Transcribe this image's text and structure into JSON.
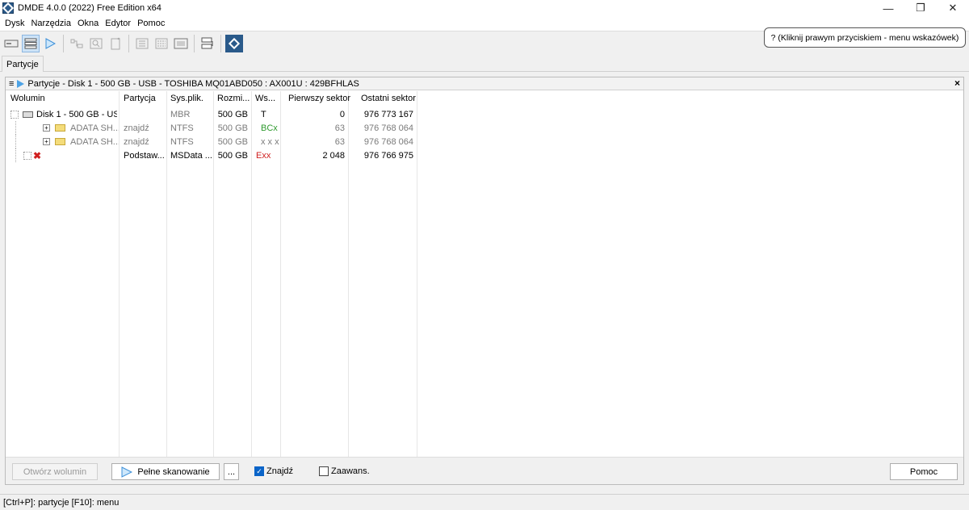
{
  "window": {
    "title": "DMDE 4.0.0 (2022) Free Edition x64",
    "minimize": "—",
    "restore": "❐",
    "close": "✕"
  },
  "menu": [
    "Dysk",
    "Narzędzia",
    "Okna",
    "Edytor",
    "Pomoc"
  ],
  "tooltip": "? (Kliknij prawym przyciskiem - menu wskazówek)",
  "tab": "Partycje",
  "panel": {
    "title": "Partycje - Disk 1 - 500 GB - USB - TOSHIBA MQ01ABD050 : AX001U : 429BFHLAS",
    "close": "×"
  },
  "columns": [
    "Wolumin",
    "Partycja",
    "Sys.plik.",
    "Rozmi...",
    "Ws...",
    "Pierwszy sektor",
    "Ostatni sektor"
  ],
  "rows": [
    {
      "wolumin": "Disk 1 - 500 GB - US...",
      "partycja": "",
      "sys": "MBR",
      "size": "500 GB",
      "ws": "T",
      "first": "0",
      "last": "976 773 167"
    },
    {
      "wolumin": "ADATA SH...",
      "partycja": "znajdź",
      "sys": "NTFS",
      "size": "500 GB",
      "ws": "BCx",
      "first": "63",
      "last": "976 768 064"
    },
    {
      "wolumin": "ADATA SH...",
      "partycja": "znajdź",
      "sys": "NTFS",
      "size": "500 GB",
      "ws": "x x x",
      "first": "63",
      "last": "976 768 064"
    },
    {
      "wolumin": "",
      "partycja": "Podstaw...",
      "sys": "MSData ...",
      "size": "500 GB",
      "ws": "Exx",
      "first": "2 048",
      "last": "976 766 975"
    }
  ],
  "buttons": {
    "open_volume": "Otwórz wolumin",
    "full_scan": "Pełne skanowanie",
    "more": "...",
    "help": "Pomoc"
  },
  "checks": {
    "find": "Znajdź",
    "advanced": "Zaawans."
  },
  "status": "[Ctrl+P]: partycje  [F10]: menu"
}
